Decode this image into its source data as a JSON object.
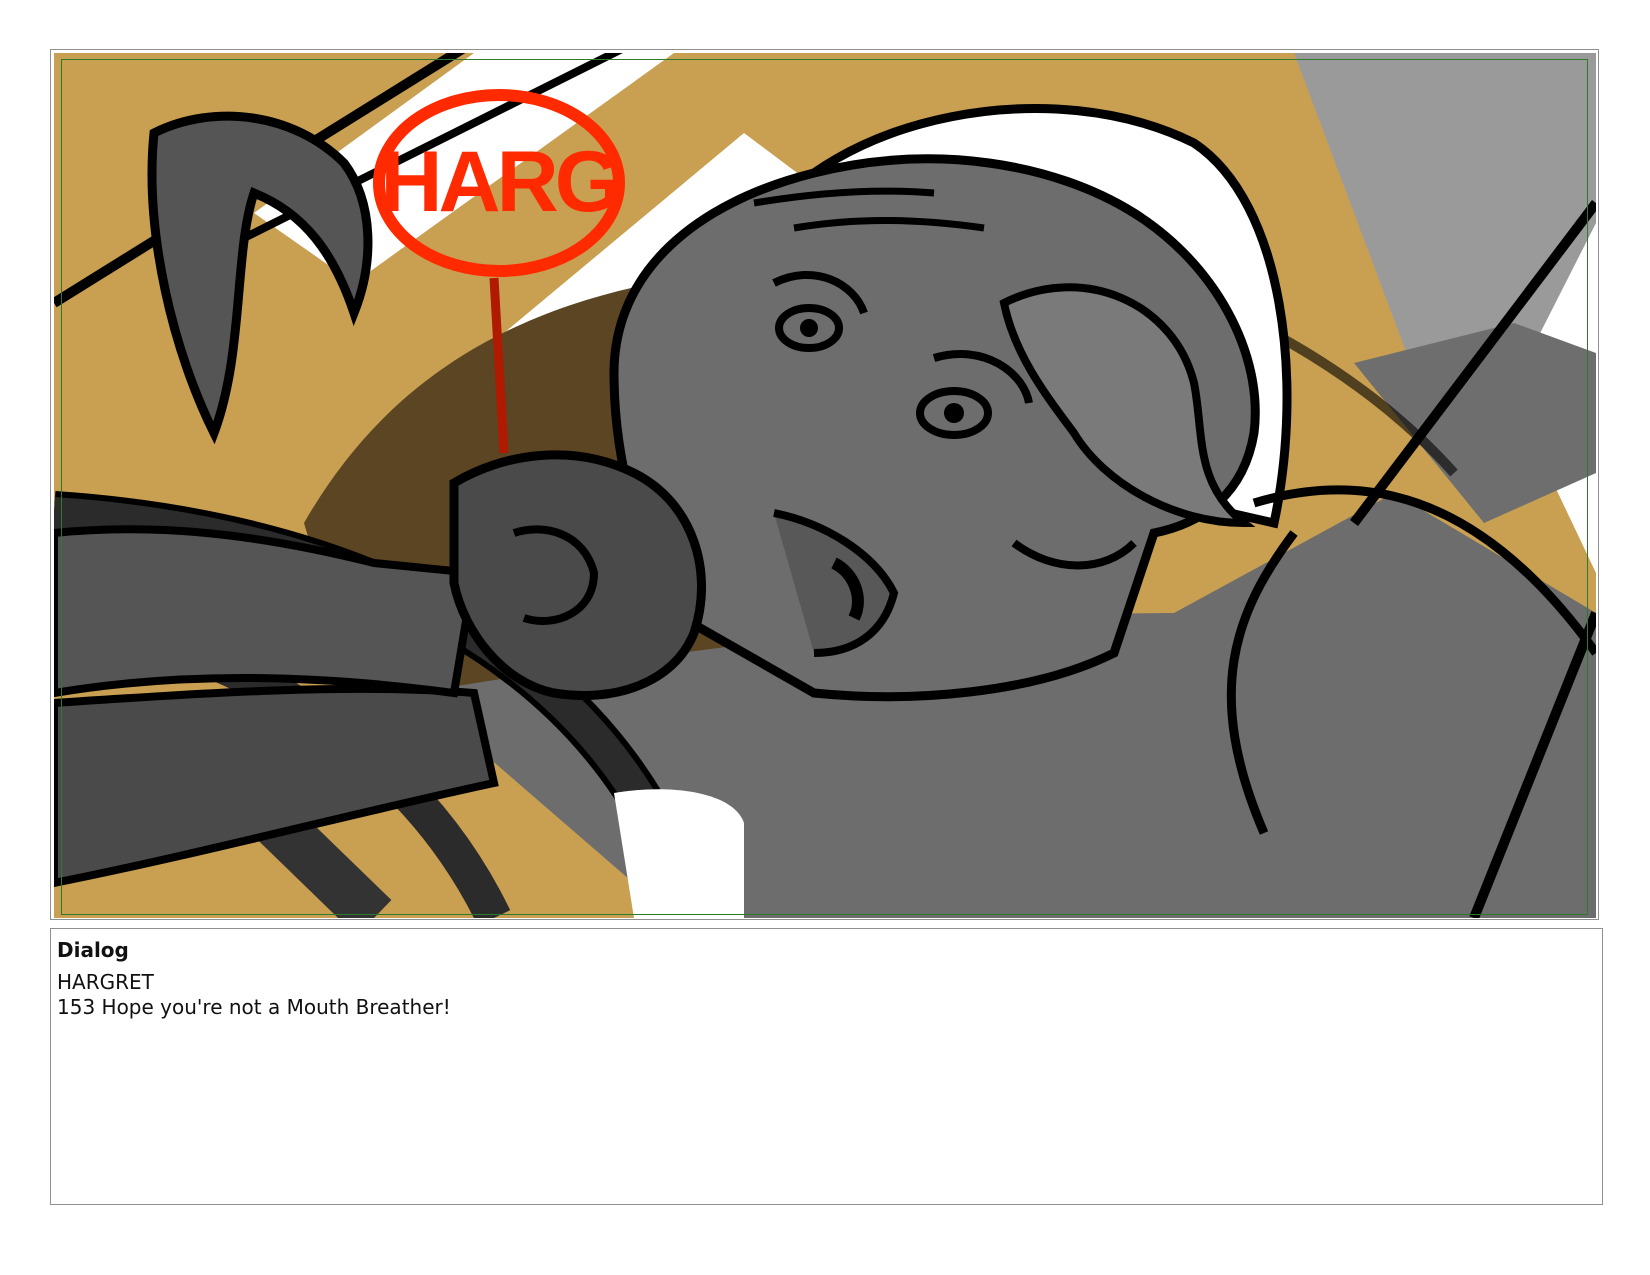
{
  "panel": {
    "sfx_text": "HARG",
    "colors": {
      "background_ochre": "#c9a051",
      "shadow_brown": "#5b4522",
      "light_gray": "#9a9a9a",
      "mid_gray": "#6d6d6d",
      "dark_gray": "#4a4a4a",
      "wheel_dark": "#2b2b2b",
      "ink": "#000000",
      "sfx_red": "#ff2a00",
      "safe_frame_green": "#2d7a2d"
    }
  },
  "dialog": {
    "heading": "Dialog",
    "speaker": "HARGRET",
    "line": "153 Hope you're not a Mouth Breather!"
  }
}
